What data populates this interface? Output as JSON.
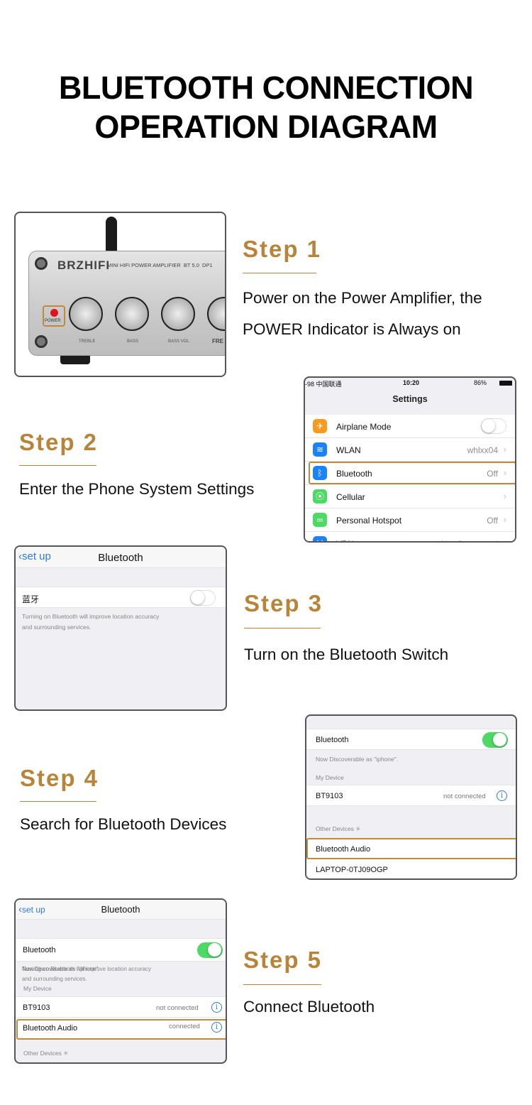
{
  "title": {
    "line1": "BLUETOOTH CONNECTION",
    "line2": "OPERATION DIAGRAM"
  },
  "accent_color": "#b8843a",
  "steps": [
    {
      "label": "Step 1",
      "desc_lines": [
        "Power on the Power Amplifier, the",
        "POWER Indicator is Always on"
      ]
    },
    {
      "label": "Step 2",
      "desc_lines": [
        "Enter the Phone System Settings"
      ]
    },
    {
      "label": "Step 3",
      "desc_lines": [
        "Turn on the Bluetooth Switch"
      ]
    },
    {
      "label": "Step 4",
      "desc_lines": [
        "Search for Bluetooth Devices"
      ]
    },
    {
      "label": "Step 5",
      "desc_lines": [
        "Connect Bluetooth"
      ]
    }
  ],
  "amplifier": {
    "brand": "BRZHIFI",
    "model_text": "MINI HIFI POWER AMPLIFIER  BT 5.0  DP1",
    "power_label": "POWER",
    "knobs": [
      "TREBLE",
      "BASS",
      "BASS VOL",
      "FRE"
    ]
  },
  "settings_screen": {
    "carrier": "-98 中国联通",
    "time": "10:20",
    "battery": "86%",
    "title": "Settings",
    "items": [
      {
        "label": "Airplane Mode",
        "value": "",
        "icon": "airplane-icon",
        "color": "#f79a1d"
      },
      {
        "label": "WLAN",
        "value": "whlxx04",
        "icon": "wifi-icon",
        "color": "#1a82fb"
      },
      {
        "label": "Bluetooth",
        "value": "Off",
        "icon": "bluetooth-icon",
        "color": "#1a82fb"
      },
      {
        "label": "Cellular",
        "value": "",
        "icon": "cellular-icon",
        "color": "#4cd964"
      },
      {
        "label": "Personal Hotspot",
        "value": "Off",
        "icon": "hotspot-icon",
        "color": "#4cd964"
      },
      {
        "label": "VPN",
        "value": "Not Connected",
        "icon": "vpn-icon",
        "color": "#1a82fb"
      }
    ]
  },
  "bt_off_screen": {
    "back": "set up",
    "title": "Bluetooth",
    "toggle_label": "蓝牙",
    "toggle_on": false,
    "note_line1": "Turning on Bluetooth will improve location accuracy",
    "note_line2": "and surrounding services."
  },
  "bt_search_screen": {
    "toggle_label": "Bluetooth",
    "toggle_on": true,
    "discoverable": "Now Discoverable as \"iphone\".",
    "my_device_header": "My Device",
    "my_device": {
      "name": "BT9103",
      "status": "not connected"
    },
    "other_header": "Other Devices",
    "other_devices": [
      "Bluetooth  Audio",
      "LAPTOP-0TJ09OGP"
    ]
  },
  "bt_connected_screen": {
    "back": "set up",
    "title": "Bluetooth",
    "toggle_label": "Bluetooth",
    "toggle_on": true,
    "discoverable": "Now Discoverable as \"iphone\".",
    "note_line1": "Turning on Bluetooth will improve location accuracy",
    "note_line2": "and surrounding services.",
    "my_device_header": "My Device",
    "devices": [
      {
        "name": "BT9103",
        "status": "not connected"
      },
      {
        "name": "Bluetooth  Audio",
        "status": "connected"
      }
    ],
    "other_header": "Other Devices"
  }
}
